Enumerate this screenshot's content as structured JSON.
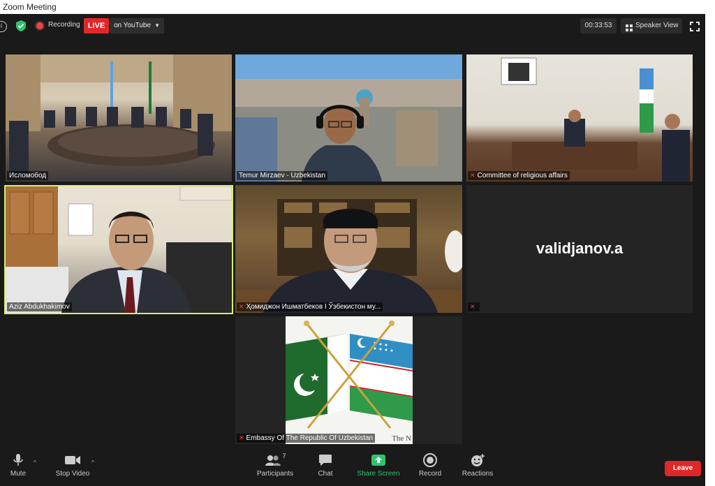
{
  "window": {
    "title": "Zoom Meeting"
  },
  "topbar": {
    "info_icon": "info-icon",
    "security_icon": "shield-icon",
    "recording_label": "Recording",
    "live_label": "LIVE",
    "stream_target": "on YouTube",
    "timer": "00:33:53",
    "view_label": "Speaker View"
  },
  "participants": [
    {
      "name": "Исломобод",
      "muted": false
    },
    {
      "name": "Temur Mirzaev - Uzbekistan",
      "muted": false
    },
    {
      "name": "Committee of religious affairs",
      "muted": true
    },
    {
      "name": "Aziz Abdukhakimov",
      "muted": false,
      "active_speaker": true
    },
    {
      "name": "Ҳомиджон Ишматбеков I Ўзбекистон му...",
      "muted": true
    },
    {
      "name": "",
      "display_name": "validjanov.a",
      "muted": true
    },
    {
      "name": "Embassy Of The Republic Of Uzbekistan",
      "muted": true,
      "caption_fragment": "The N"
    }
  ],
  "toolbar": {
    "mute_label": "Mute",
    "stop_video_label": "Stop Video",
    "participants_label": "Participants",
    "participants_count": "7",
    "chat_label": "Chat",
    "share_screen_label": "Share Screen",
    "record_label": "Record",
    "reactions_label": "Reactions",
    "leave_label": "Leave"
  },
  "colors": {
    "live": "#e02828",
    "active_speaker_border": "#d6f06a",
    "share_screen": "#2ec46b",
    "leave": "#e02828",
    "muted_icon": "#e34848"
  }
}
